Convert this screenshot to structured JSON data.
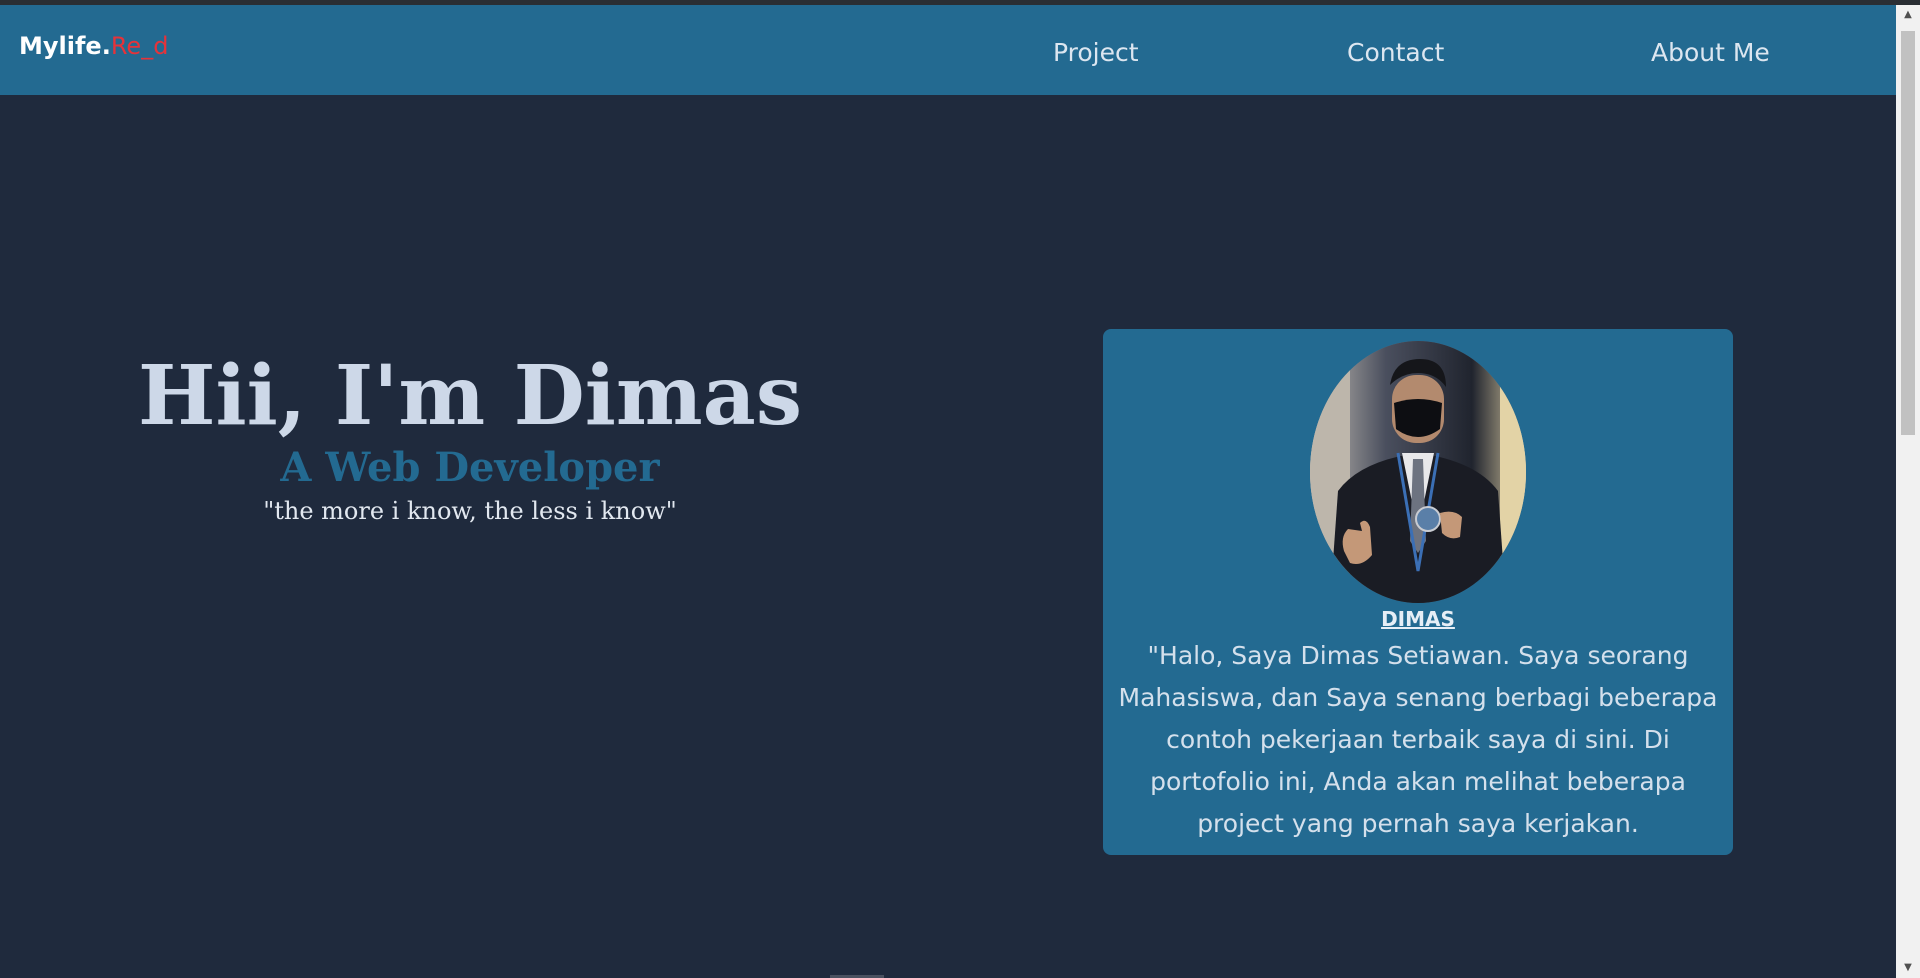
{
  "navbar": {
    "brand_main": "Mylife.",
    "brand_accent": "Re_d",
    "links": [
      {
        "label": "Project"
      },
      {
        "label": "Contact"
      },
      {
        "label": "About Me"
      }
    ]
  },
  "hero": {
    "title": "Hii, I'm Dimas",
    "subtitle": "A Web Developer",
    "quote": "\"the more i know, the less i know\""
  },
  "profile_card": {
    "name": "DIMAS",
    "bio": "\"Halo, Saya Dimas Setiawan. Saya seorang Mahasiswa, dan Saya senang berbagi beberapa contoh pekerjaan terbaik saya di sini. Di portofolio ini, Anda akan melihat beberapa project yang pernah saya kerjakan."
  },
  "colors": {
    "page_bg": "#1f2a3d",
    "navbar_bg": "#236a91",
    "brand_accent": "#e5333a",
    "card_bg": "#236a91"
  },
  "icons": {
    "scroll_up": "scroll-up-arrow-icon",
    "scroll_down": "scroll-down-arrow-icon"
  }
}
